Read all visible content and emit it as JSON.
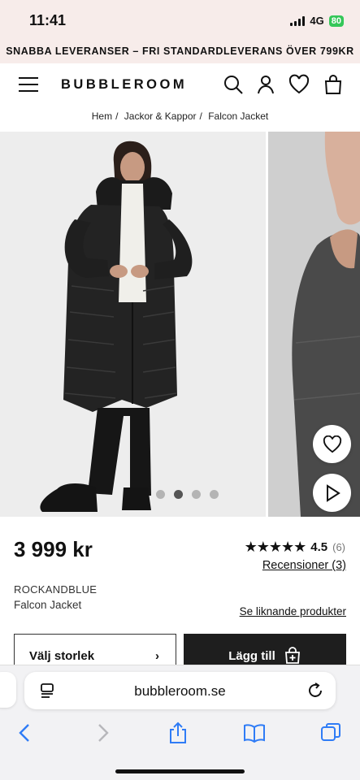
{
  "status": {
    "time": "11:41",
    "network": "4G",
    "battery": "80"
  },
  "promo": {
    "text": "SNABBA LEVERANSER – FRI STANDARDLEVERANS ÖVER 799KR"
  },
  "header": {
    "logo": "BUBBLEROOM"
  },
  "breadcrumb": {
    "items": [
      "Hem",
      "Jackor & Kappor",
      "Falcon Jacket"
    ],
    "separator": "/"
  },
  "gallery": {
    "image_count": 4,
    "active_index": 1
  },
  "product": {
    "price": "3 999 kr",
    "rating_stars": "★★★★★",
    "rating": "4.5",
    "rating_count": "(6)",
    "reviews_label": "Recensioner (3)",
    "brand": "ROCKANDBLUE",
    "name": "Falcon Jacket",
    "similar_label": "Se liknande produkter"
  },
  "actions": {
    "size_label": "Välj storlek",
    "size_chevron": "›",
    "add_label": "Lägg till"
  },
  "browser": {
    "url": "bubbleroom.se"
  },
  "icons": {
    "search": "search-icon",
    "account": "account-icon",
    "wishlist": "heart-icon",
    "bag": "bag-icon",
    "back": "back-icon",
    "forward": "forward-icon",
    "share": "share-icon",
    "bookmarks": "bookmarks-icon",
    "tabs": "tabs-icon"
  },
  "colors": {
    "promo_bg": "#f7ecea",
    "cta_bg": "#1e1e1e",
    "safari_blue": "#2f7cf6",
    "battery": "#35c759"
  }
}
